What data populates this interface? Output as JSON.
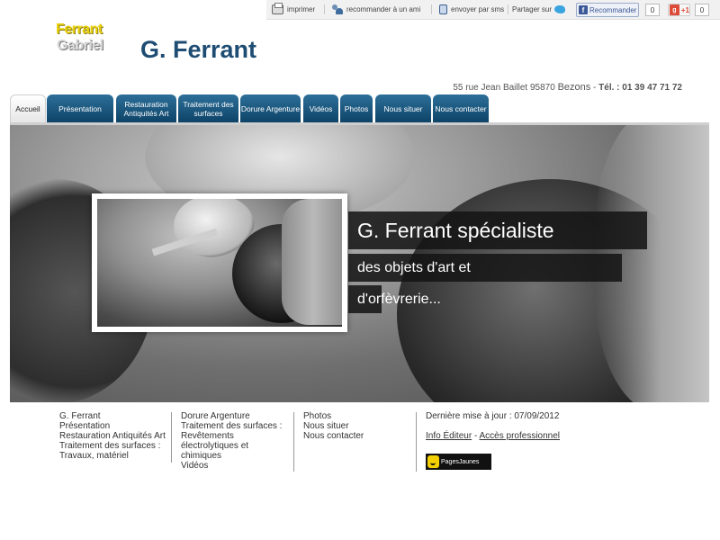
{
  "topbar": {
    "print_label": "imprimer",
    "recommend_friend_label": "recommander à un ami",
    "sms_label": "envoyer par sms",
    "share_label": "Partager sur",
    "facebook_label": "Recommander",
    "facebook_count": "0",
    "gplus_label": "+1",
    "gplus_count": "0"
  },
  "header": {
    "logo_line1": "Ferrant",
    "logo_line2": "Gabriel",
    "title": "G. Ferrant",
    "address": "55 rue Jean Baillet 95870",
    "city": "Bezons",
    "tel_label": "Tél. : 01 39 47 71 72"
  },
  "nav": {
    "tabs": [
      {
        "label": "Accueil"
      },
      {
        "label": "Présentation"
      },
      {
        "label": "Restauration Antiquités Art"
      },
      {
        "label": "Traitement des surfaces"
      },
      {
        "label": "Dorure Argenture"
      },
      {
        "label": "Vidéos"
      },
      {
        "label": "Photos"
      },
      {
        "label": "Nous situer"
      },
      {
        "label": "Nous contacter"
      }
    ]
  },
  "hero": {
    "caption_line1": "G. Ferrant spécialiste",
    "caption_line2": "des objets d'art et",
    "caption_line3": "d'orfèvrerie..."
  },
  "footer": {
    "col1": [
      "G. Ferrant",
      "Présentation",
      "Restauration Antiquités Art",
      "Traitement des surfaces :",
      "Travaux, matériel"
    ],
    "col2": [
      "Dorure Argenture",
      "Traitement des surfaces :",
      "Revêtements",
      "électrolytiques et",
      "chimiques",
      "Vidéos"
    ],
    "col3": [
      "Photos",
      "Nous situer",
      "Nous contacter"
    ],
    "last_update": "Dernière mise à jour : 07/09/2012",
    "editor_link": "Info Éditeur",
    "link_separator": "-",
    "pro_link": "Accès professionnel",
    "pagesjaunes_label": "PagesJaunes"
  }
}
